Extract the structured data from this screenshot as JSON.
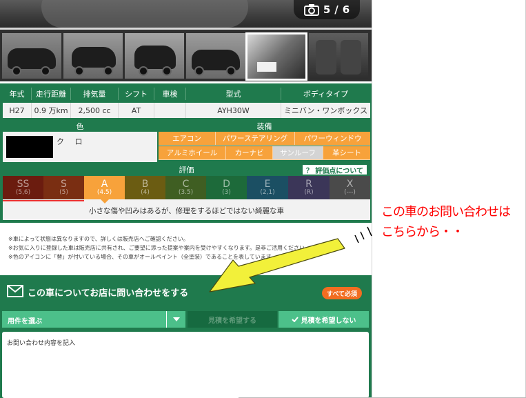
{
  "photo": {
    "counter_current": "5",
    "counter_sep": "/",
    "counter_total": "6"
  },
  "spec": {
    "headers": [
      "年式",
      "走行距離",
      "排気量",
      "シフト",
      "車検",
      "型式",
      "ボディタイプ"
    ],
    "values": [
      "H27",
      "0.9 万km",
      "2,500 cc",
      "AT",
      "",
      "AYH30W",
      "ミニバン・ワンボックス"
    ],
    "color_header": "色",
    "color_name": "ク ロ",
    "equip_header": "装備",
    "equipment": [
      {
        "label": "エアコン",
        "on": true
      },
      {
        "label": "パワーステアリング",
        "on": true
      },
      {
        "label": "パワーウィンドウ",
        "on": true
      },
      {
        "label": "アルミホイール",
        "on": true
      },
      {
        "label": "カーナビ",
        "on": true
      },
      {
        "label": "サンルーフ",
        "on": false
      },
      {
        "label": "革シート",
        "on": true
      }
    ],
    "eval_header": "評価",
    "eval_link": "？ 評価点について",
    "grades": [
      {
        "g": "SS",
        "s": "(5,6)",
        "color": "#6b1c0f"
      },
      {
        "g": "S",
        "s": "(5)",
        "color": "#7a2e12"
      },
      {
        "g": "A",
        "s": "(4.5)",
        "color": "#f7a23b",
        "active": true
      },
      {
        "g": "B",
        "s": "(4)",
        "color": "#6b5c12"
      },
      {
        "g": "C",
        "s": "(3.5)",
        "color": "#3f5e22"
      },
      {
        "g": "D",
        "s": "(3)",
        "color": "#1d6a3a"
      },
      {
        "g": "E",
        "s": "(2,1)",
        "color": "#1b4f63"
      },
      {
        "g": "R",
        "s": "(R)",
        "color": "#3b3658"
      },
      {
        "g": "X",
        "s": "(---)",
        "color": "#4a4a4a"
      }
    ],
    "eval_desc": "小さな傷や凹みはあるが、修理をするほどではない綺麗な車"
  },
  "notes": [
    "※車によって状態は異なりますので、詳しくは販売店へご確認ください。",
    "※お気に入りに登録した車は販売店に共有され、ご要望に添った提案や案内を受けやすくなります。是非ご活用ください。",
    "※色のアイコンに「替」が付いている場合、その車がオールペイント（全塗装）であることを表しています。"
  ],
  "inquiry": {
    "title": "この車についてお店に問い合わせをする",
    "required_badge": "すべて必須",
    "select_label": "用件を選ぶ",
    "estimate_want": "見積を希望する",
    "estimate_no": "見積を希望しない",
    "textarea_placeholder": "お問い合わせ内容を記入"
  },
  "annotation": {
    "line1": "この車のお問い合わせは",
    "line2": "こちらから・・"
  }
}
